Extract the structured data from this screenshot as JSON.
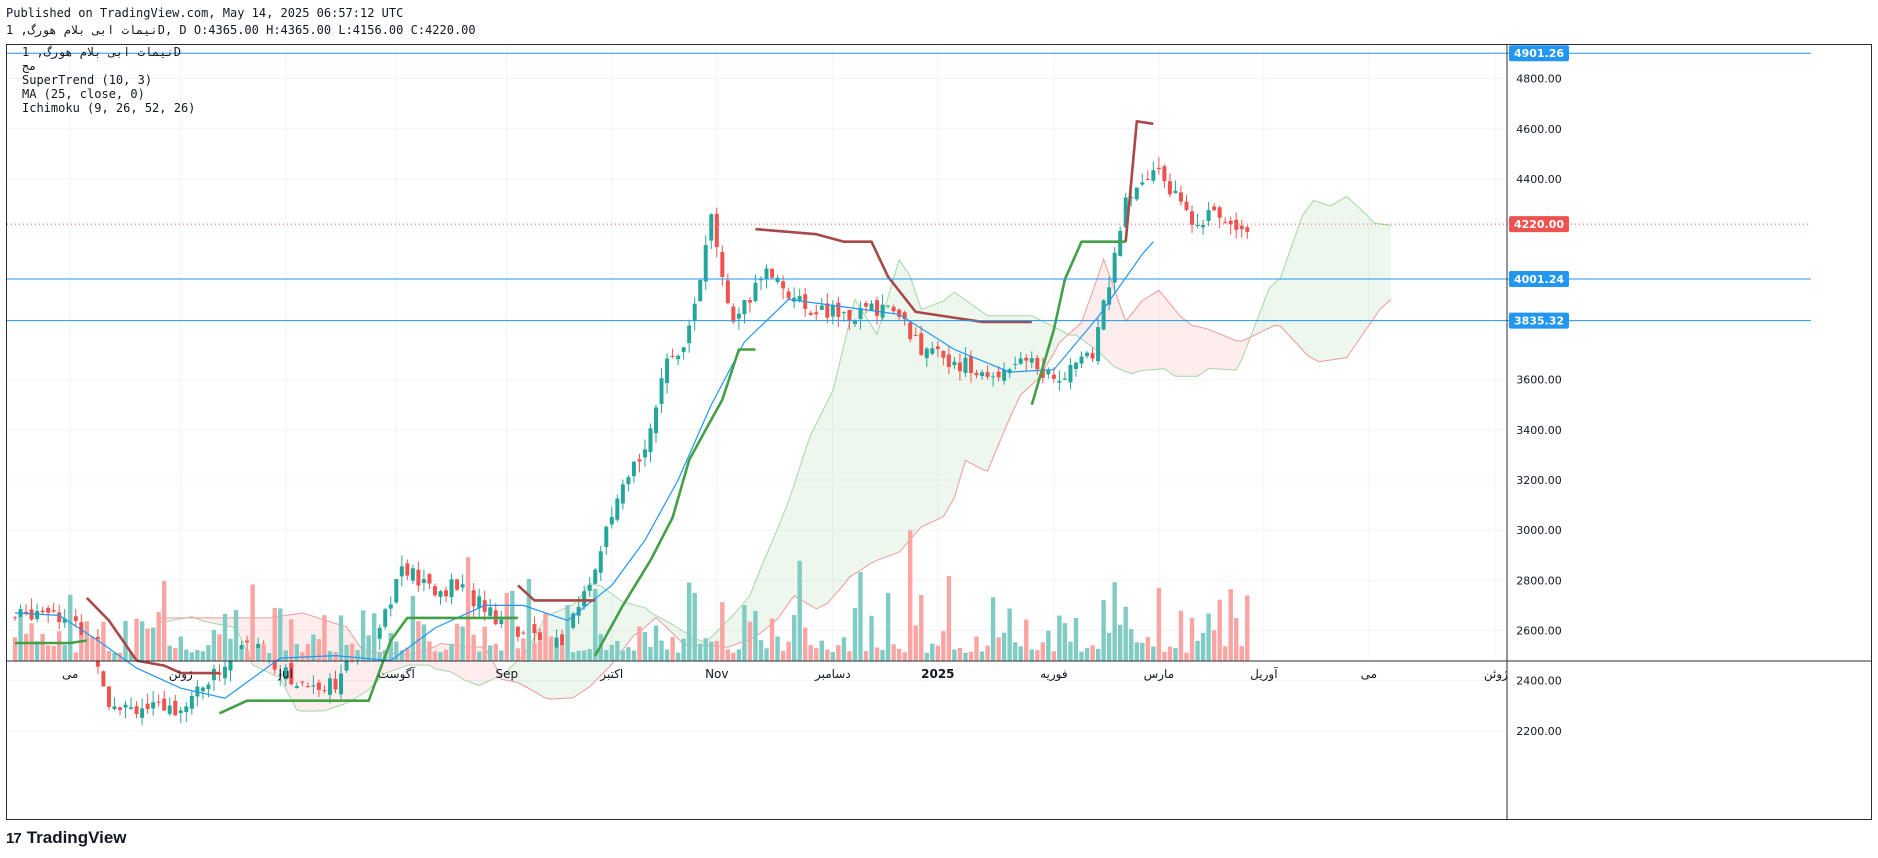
{
  "header": {
    "published": "Published on TradingView.com, May 14, 2025 06:57:12 UTC",
    "ohlc_line": "نیمات ابی بلام هورگ, 1D, D O:4365.00 H:4365.00 L:4156.00 C:4220.00"
  },
  "legend": {
    "line1": "نیمات ابی بلام هورگ, 1D",
    "line2": "مج",
    "line3": "SuperTrend (10, 3)",
    "line4": "MA (25, close, 0)",
    "line5": "Ichimoku (9, 26, 52, 26)"
  },
  "footer": {
    "logo_text": "TradingView",
    "logo_mark": "17"
  },
  "colors": {
    "up": "#26a69a",
    "down": "#ef5350",
    "up_volume": "#80cbc4",
    "down_volume": "#f8a5a3",
    "supertrend_up": "#43a047",
    "supertrend_down": "#a84848",
    "ma": "#2196f3",
    "hline": "#2196f3",
    "grid": "#f0f3fa"
  },
  "chart_data": {
    "type": "candlestick",
    "symbol": "نیمات ابی بلام هورگ",
    "interval": "1D",
    "ohlc_last": {
      "open": 4365.0,
      "high": 4365.0,
      "low": 4156.0,
      "close": 4220.0
    },
    "ylim": [
      2000,
      4950
    ],
    "y_ticks": [
      "4800.00",
      "4600.00",
      "4400.00",
      "3600.00",
      "3400.00",
      "3200.00",
      "3000.00",
      "2800.00",
      "2600.00",
      "2400.00",
      "2200.00"
    ],
    "x_labels": [
      "می",
      "ژوئن",
      "Jul",
      "آگوست",
      "Sep",
      "اکتبر",
      "Nov",
      "دسامبر",
      "2025",
      "فوریه",
      "مارس",
      "آوریل",
      "می",
      "ژوئن"
    ],
    "horizontal_lines": [
      {
        "value": 4901.26,
        "label": "4901.26"
      },
      {
        "value": 4001.24,
        "label": "4001.24"
      },
      {
        "value": 3835.32,
        "label": "3835.32"
      }
    ],
    "last_price": {
      "value": 4220.0,
      "label": "4220.00"
    },
    "indicators": [
      "SuperTrend (10, 3)",
      "MA (25, close, 0)",
      "Ichimoku (9, 26, 52, 26)"
    ],
    "close_path": [
      [
        0,
        2650
      ],
      [
        6,
        2700
      ],
      [
        10,
        2630
      ],
      [
        14,
        2560
      ],
      [
        17,
        2320
      ],
      [
        22,
        2300
      ],
      [
        26,
        2280
      ],
      [
        30,
        2300
      ],
      [
        36,
        2420
      ],
      [
        41,
        2540
      ],
      [
        45,
        2520
      ],
      [
        50,
        2400
      ],
      [
        55,
        2380
      ],
      [
        58,
        2400
      ],
      [
        62,
        2500
      ],
      [
        67,
        2680
      ],
      [
        70,
        2850
      ],
      [
        76,
        2750
      ],
      [
        80,
        2780
      ],
      [
        85,
        2700
      ],
      [
        89,
        2620
      ],
      [
        94,
        2580
      ],
      [
        99,
        2540
      ],
      [
        104,
        2800
      ],
      [
        109,
        3100
      ],
      [
        114,
        3350
      ],
      [
        118,
        3650
      ],
      [
        122,
        3800
      ],
      [
        126,
        4230
      ],
      [
        130,
        3800
      ],
      [
        136,
        4050
      ],
      [
        142,
        3900
      ],
      [
        150,
        3850
      ],
      [
        158,
        3900
      ],
      [
        165,
        3700
      ],
      [
        170,
        3680
      ],
      [
        176,
        3600
      ],
      [
        182,
        3700
      ],
      [
        188,
        3600
      ],
      [
        195,
        3700
      ],
      [
        201,
        4300
      ],
      [
        207,
        4450
      ],
      [
        212,
        4250
      ],
      [
        218,
        4250
      ],
      [
        223,
        4220
      ]
    ],
    "supertrend": [
      {
        "trend": "up",
        "points": [
          [
            0,
            2550
          ],
          [
            10,
            2550
          ],
          [
            13,
            2560
          ]
        ]
      },
      {
        "trend": "down",
        "points": [
          [
            13,
            2730
          ],
          [
            17,
            2640
          ],
          [
            22,
            2480
          ],
          [
            27,
            2460
          ],
          [
            30,
            2430
          ],
          [
            37,
            2430
          ]
        ]
      },
      {
        "trend": "up",
        "points": [
          [
            37,
            2270
          ],
          [
            42,
            2320
          ],
          [
            64,
            2320
          ],
          [
            68,
            2560
          ],
          [
            71,
            2650
          ],
          [
            91,
            2650
          ]
        ]
      },
      {
        "trend": "down",
        "points": [
          [
            91,
            2780
          ],
          [
            94,
            2720
          ],
          [
            105,
            2720
          ]
        ]
      },
      {
        "trend": "up",
        "points": [
          [
            105,
            2500
          ],
          [
            110,
            2700
          ],
          [
            115,
            2880
          ],
          [
            119,
            3050
          ],
          [
            122,
            3280
          ],
          [
            125,
            3400
          ],
          [
            128,
            3520
          ],
          [
            131,
            3720
          ],
          [
            134,
            3720
          ]
        ]
      },
      {
        "trend": "down",
        "points": [
          [
            134,
            4200
          ],
          [
            145,
            4180
          ],
          [
            150,
            4150
          ],
          [
            155,
            4150
          ],
          [
            158,
            4010
          ],
          [
            163,
            3870
          ],
          [
            175,
            3830
          ],
          [
            184,
            3830
          ]
        ]
      },
      {
        "trend": "up",
        "points": [
          [
            184,
            3500
          ],
          [
            188,
            3800
          ],
          [
            190,
            4000
          ],
          [
            193,
            4150
          ],
          [
            201,
            4150
          ]
        ]
      },
      {
        "trend": "down",
        "points": [
          [
            201,
            4150
          ],
          [
            203,
            4630
          ],
          [
            206,
            4620
          ]
        ]
      }
    ],
    "moving_average": [
      [
        0,
        2670
      ],
      [
        8,
        2660
      ],
      [
        15,
        2560
      ],
      [
        22,
        2450
      ],
      [
        30,
        2370
      ],
      [
        38,
        2330
      ],
      [
        48,
        2490
      ],
      [
        58,
        2500
      ],
      [
        68,
        2480
      ],
      [
        76,
        2610
      ],
      [
        85,
        2700
      ],
      [
        92,
        2700
      ],
      [
        100,
        2640
      ],
      [
        108,
        2780
      ],
      [
        114,
        2960
      ],
      [
        120,
        3200
      ],
      [
        126,
        3500
      ],
      [
        132,
        3750
      ],
      [
        140,
        3920
      ],
      [
        150,
        3890
      ],
      [
        160,
        3860
      ],
      [
        170,
        3720
      ],
      [
        180,
        3630
      ],
      [
        188,
        3640
      ],
      [
        196,
        3850
      ],
      [
        204,
        4100
      ],
      [
        206,
        4150
      ]
    ],
    "volume": {
      "max_label": "",
      "note": "relative bars, up/down colored"
    }
  }
}
